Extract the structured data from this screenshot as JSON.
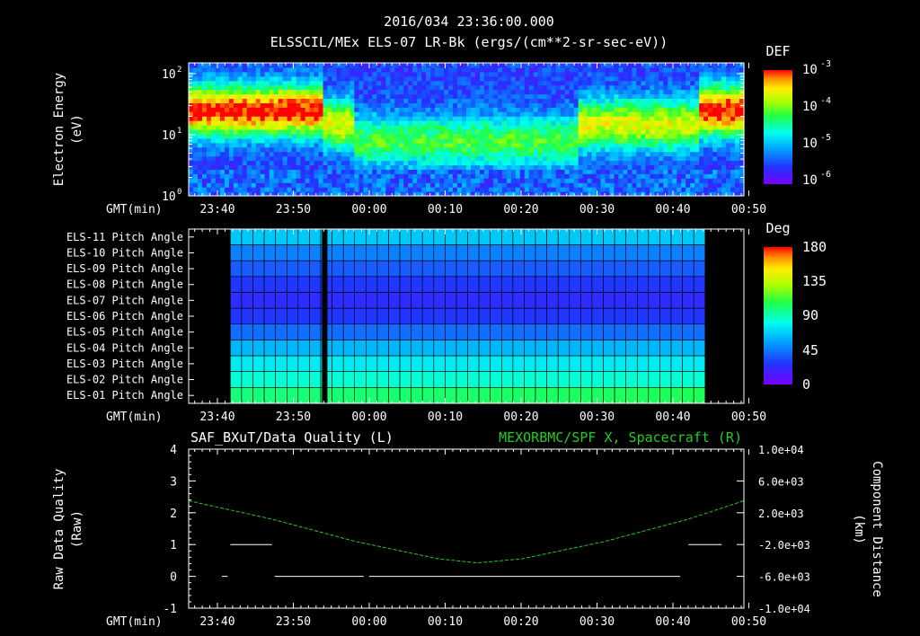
{
  "header": {
    "timestamp": "2016/034 23:36:00.000",
    "subtitle": "ELSSCIL/MEx ELS-07 LR-Bk  (ergs/(cm**2-sr-sec-eV))"
  },
  "time_axis": {
    "label": "GMT(min)",
    "ticks": [
      "23:40",
      "23:50",
      "00:00",
      "00:10",
      "00:20",
      "00:30",
      "00:40",
      "00:50"
    ]
  },
  "colors": {
    "background": "#000000",
    "frame": "#ffffff",
    "spf_x_trace": "#22cc22"
  },
  "chart_data": [
    {
      "type": "heatmap",
      "name": "energy-spectrogram",
      "ylabel": "Electron Energy",
      "yunits": "(eV)",
      "yscale": "log",
      "ylim": [
        1,
        150
      ],
      "y_ticks": [
        {
          "base": "10",
          "exp": "0"
        },
        {
          "base": "10",
          "exp": "1"
        },
        {
          "base": "10",
          "exp": "2"
        }
      ],
      "colorbar": {
        "title": "DEF",
        "scale": "log",
        "ticks": [
          {
            "base": "10",
            "exp": "-3"
          },
          {
            "base": "10",
            "exp": "-4"
          },
          {
            "base": "10",
            "exp": "-5"
          },
          {
            "base": "10",
            "exp": "-6"
          }
        ]
      },
      "features": [
        {
          "x_range_min": [
            0,
            24
          ],
          "energy_peak_ev": 25,
          "level": "high"
        },
        {
          "x_range_min": [
            24,
            30
          ],
          "energy_peak_ev": 15,
          "level": "medium"
        },
        {
          "x_range_min": [
            30,
            70
          ],
          "energy_peak_ev": 8,
          "level": "low"
        },
        {
          "x_range_min": [
            70,
            92
          ],
          "energy_peak_ev": 15,
          "level": "medium"
        },
        {
          "x_range_min": [
            92,
            100
          ],
          "energy_peak_ev": 25,
          "level": "high"
        }
      ]
    },
    {
      "type": "heatmap",
      "name": "pitch-angle",
      "rows": [
        "ELS-11 Pitch Angle",
        "ELS-10 Pitch Angle",
        "ELS-09 Pitch Angle",
        "ELS-08 Pitch Angle",
        "ELS-07 Pitch Angle",
        "ELS-06 Pitch Angle",
        "ELS-05 Pitch Angle",
        "ELS-04 Pitch Angle",
        "ELS-03 Pitch Angle",
        "ELS-02 Pitch Angle",
        "ELS-01 Pitch Angle"
      ],
      "row_values_deg": [
        60,
        40,
        30,
        20,
        15,
        20,
        35,
        55,
        70,
        80,
        95
      ],
      "data_x_range_min": [
        7.5,
        93
      ],
      "gap_at_min": 24.5,
      "colorbar": {
        "title": "Deg",
        "min": 0,
        "max": 180,
        "ticks": [
          "180",
          "135",
          "90",
          "45",
          "0"
        ]
      }
    },
    {
      "type": "line",
      "name": "data-quality",
      "title_left": "SAF_BXuT/Data Quality (L)",
      "title_right": "MEXORBMC/SPF X, Spacecraft (R)",
      "ylabel_left": "Raw Data Quality",
      "yunits_left": "(Raw)",
      "ylim_left": [
        -1,
        4
      ],
      "left_ticks": [
        "4",
        "3",
        "2",
        "1",
        "0",
        "-1"
      ],
      "ylabel_right": "Component Distance",
      "yunits_right": "(km)",
      "ylim_right": [
        -10000,
        10000
      ],
      "right_ticks": [
        "1.0e+04",
        "6.0e+03",
        "2.0e+03",
        "-2.0e+03",
        "-6.0e+03",
        "-1.0e+04"
      ],
      "quality_segments": [
        {
          "x": [
            6,
            7
          ],
          "y": 0
        },
        {
          "x": [
            7.5,
            15
          ],
          "y": 1
        },
        {
          "x": [
            15.5,
            31.5
          ],
          "y": 0
        },
        {
          "x": [
            32.5,
            88.5
          ],
          "y": 0
        },
        {
          "x": [
            90,
            96
          ],
          "y": 1
        }
      ],
      "spf_x_km": [
        {
          "t": 0,
          "v": 3500
        },
        {
          "t": 15,
          "v": 1200
        },
        {
          "t": 30,
          "v": -1600
        },
        {
          "t": 45,
          "v": -3800
        },
        {
          "t": 52,
          "v": -4300
        },
        {
          "t": 60,
          "v": -3800
        },
        {
          "t": 75,
          "v": -1600
        },
        {
          "t": 90,
          "v": 1200
        },
        {
          "t": 100,
          "v": 3500
        }
      ]
    }
  ]
}
